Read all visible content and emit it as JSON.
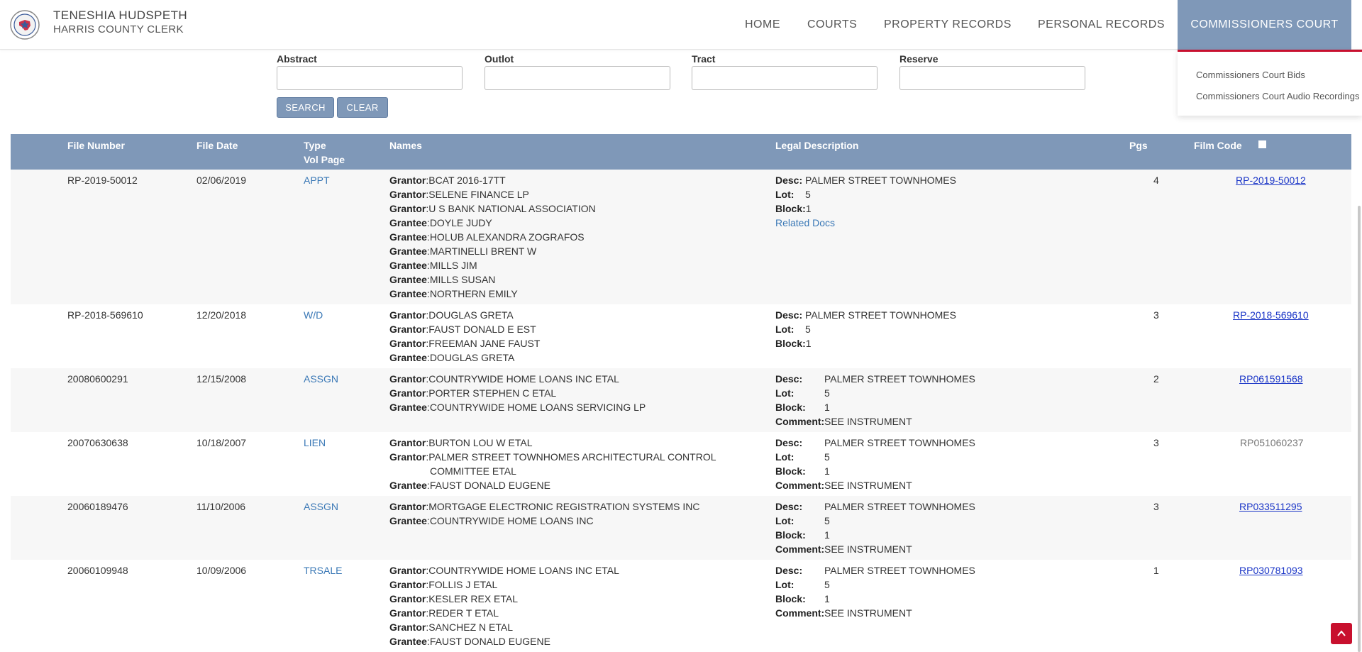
{
  "header": {
    "clerk_name": "TENESHIA HUDSPETH",
    "clerk_title": "HARRIS COUNTY CLERK",
    "seal_icon": "county-seal-icon"
  },
  "nav": {
    "home": "HOME",
    "courts": "COURTS",
    "property_records": "PROPERTY RECORDS",
    "personal_records": "PERSONAL RECORDS",
    "commissioners_court": "COMMISSIONERS COURT",
    "active_color": "#7f98b8",
    "dropdown": [
      "Commissioners Court Bids",
      "Commissioners Court Audio Recordings"
    ]
  },
  "search": {
    "abstract_label": "Abstract",
    "outlot_label": "Outlot",
    "tract_label": "Tract",
    "reserve_label": "Reserve",
    "abstract_value": "",
    "outlot_value": "",
    "tract_value": "",
    "reserve_value": "",
    "search_label": "SEARCH",
    "clear_label": "CLEAR"
  },
  "table": {
    "headers": {
      "file_number": "File Number",
      "file_date": "File Date",
      "type": "Type",
      "vol_page": "Vol Page",
      "names": "Names",
      "legal_description": "Legal Description",
      "pgs": "Pgs",
      "film_code": "Film Code"
    },
    "rows": [
      {
        "file_number": "RP-2019-50012",
        "file_date": "02/06/2019",
        "type": "APPT",
        "names": [
          {
            "role": "Grantor",
            "name": "BCAT 2016-17TT"
          },
          {
            "role": "Grantor",
            "name": "SELENE FINANCE LP"
          },
          {
            "role": "Grantor",
            "name": "U S BANK NATIONAL ASSOCIATION"
          },
          {
            "role": "Grantee",
            "name": "DOYLE JUDY"
          },
          {
            "role": "Grantee",
            "name": "HOLUB ALEXANDRA ZOGRAFOS"
          },
          {
            "role": "Grantee",
            "name": "MARTINELLI BRENT W"
          },
          {
            "role": "Grantee",
            "name": "MILLS JIM"
          },
          {
            "role": "Grantee",
            "name": "MILLS SUSAN"
          },
          {
            "role": "Grantee",
            "name": "NORTHERN EMILY"
          }
        ],
        "desc": "PALMER STREET TOWNHOMES",
        "lot": "5",
        "block": "1",
        "related_docs": "Related Docs",
        "pgs": "4",
        "film_code": "RP-2019-50012"
      },
      {
        "file_number": "RP-2018-569610",
        "file_date": "12/20/2018",
        "type": "W/D",
        "names": [
          {
            "role": "Grantor",
            "name": "DOUGLAS GRETA"
          },
          {
            "role": "Grantor",
            "name": "FAUST DONALD E EST"
          },
          {
            "role": "Grantor",
            "name": "FREEMAN JANE FAUST"
          },
          {
            "role": "Grantee",
            "name": "DOUGLAS GRETA"
          }
        ],
        "desc": "PALMER STREET TOWNHOMES",
        "lot": "5",
        "block": "1",
        "pgs": "3",
        "film_code": "RP-2018-569610"
      },
      {
        "file_number": "20080600291",
        "file_date": "12/15/2008",
        "type": "ASSGN",
        "names": [
          {
            "role": "Grantor",
            "name": "COUNTRYWIDE HOME LOANS INC ETAL"
          },
          {
            "role": "Grantor",
            "name": "PORTER STEPHEN C ETAL"
          },
          {
            "role": "Grantee",
            "name": "COUNTRYWIDE HOME LOANS SERVICING LP"
          }
        ],
        "desc": "PALMER STREET TOWNHOMES",
        "lot": "5",
        "block": "1",
        "comment": "SEE INSTRUMENT",
        "pgs": "2",
        "film_code": "RP061591568"
      },
      {
        "file_number": "20070630638",
        "file_date": "10/18/2007",
        "type": "LIEN",
        "names": [
          {
            "role": "Grantor",
            "name": "BURTON LOU W ETAL"
          },
          {
            "role": "Grantor",
            "name": "PALMER STREET TOWNHOMES ARCHITECTURAL CONTROL",
            "cont": "COMMITTEE ETAL"
          },
          {
            "role": "Grantee",
            "name": "FAUST DONALD EUGENE"
          }
        ],
        "desc": "PALMER STREET TOWNHOMES",
        "lot": "5",
        "block": "1",
        "comment": "SEE INSTRUMENT",
        "pgs": "3",
        "film_code": "RP051060237"
      },
      {
        "file_number": "20060189476",
        "file_date": "11/10/2006",
        "type": "ASSGN",
        "names": [
          {
            "role": "Grantor",
            "name": "MORTGAGE ELECTRONIC REGISTRATION SYSTEMS INC"
          },
          {
            "role": "Grantee",
            "name": "COUNTRYWIDE HOME LOANS INC"
          }
        ],
        "desc": "PALMER STREET TOWNHOMES",
        "lot": "5",
        "block": "1",
        "comment": "SEE INSTRUMENT",
        "pgs": "3",
        "film_code": "RP033511295"
      },
      {
        "file_number": "20060109948",
        "file_date": "10/09/2006",
        "type": "TRSALE",
        "names": [
          {
            "role": "Grantor",
            "name": "COUNTRYWIDE HOME LOANS INC ETAL"
          },
          {
            "role": "Grantor",
            "name": "FOLLIS J ETAL"
          },
          {
            "role": "Grantor",
            "name": "KESLER REX ETAL"
          },
          {
            "role": "Grantor",
            "name": "REDER T ETAL"
          },
          {
            "role": "Grantor",
            "name": "SANCHEZ N ETAL"
          },
          {
            "role": "Grantee",
            "name": "FAUST DONALD EUGENE"
          }
        ],
        "desc": "PALMER STREET TOWNHOMES",
        "lot": "5",
        "block": "1",
        "comment": "SEE INSTRUMENT",
        "pgs": "1",
        "film_code": "RP030781093"
      }
    ]
  },
  "colors": {
    "accent_blue": "#7f98b8",
    "brand_red": "#c8102e",
    "link_blue": "#1a35c7",
    "type_link": "#3a78b6"
  }
}
